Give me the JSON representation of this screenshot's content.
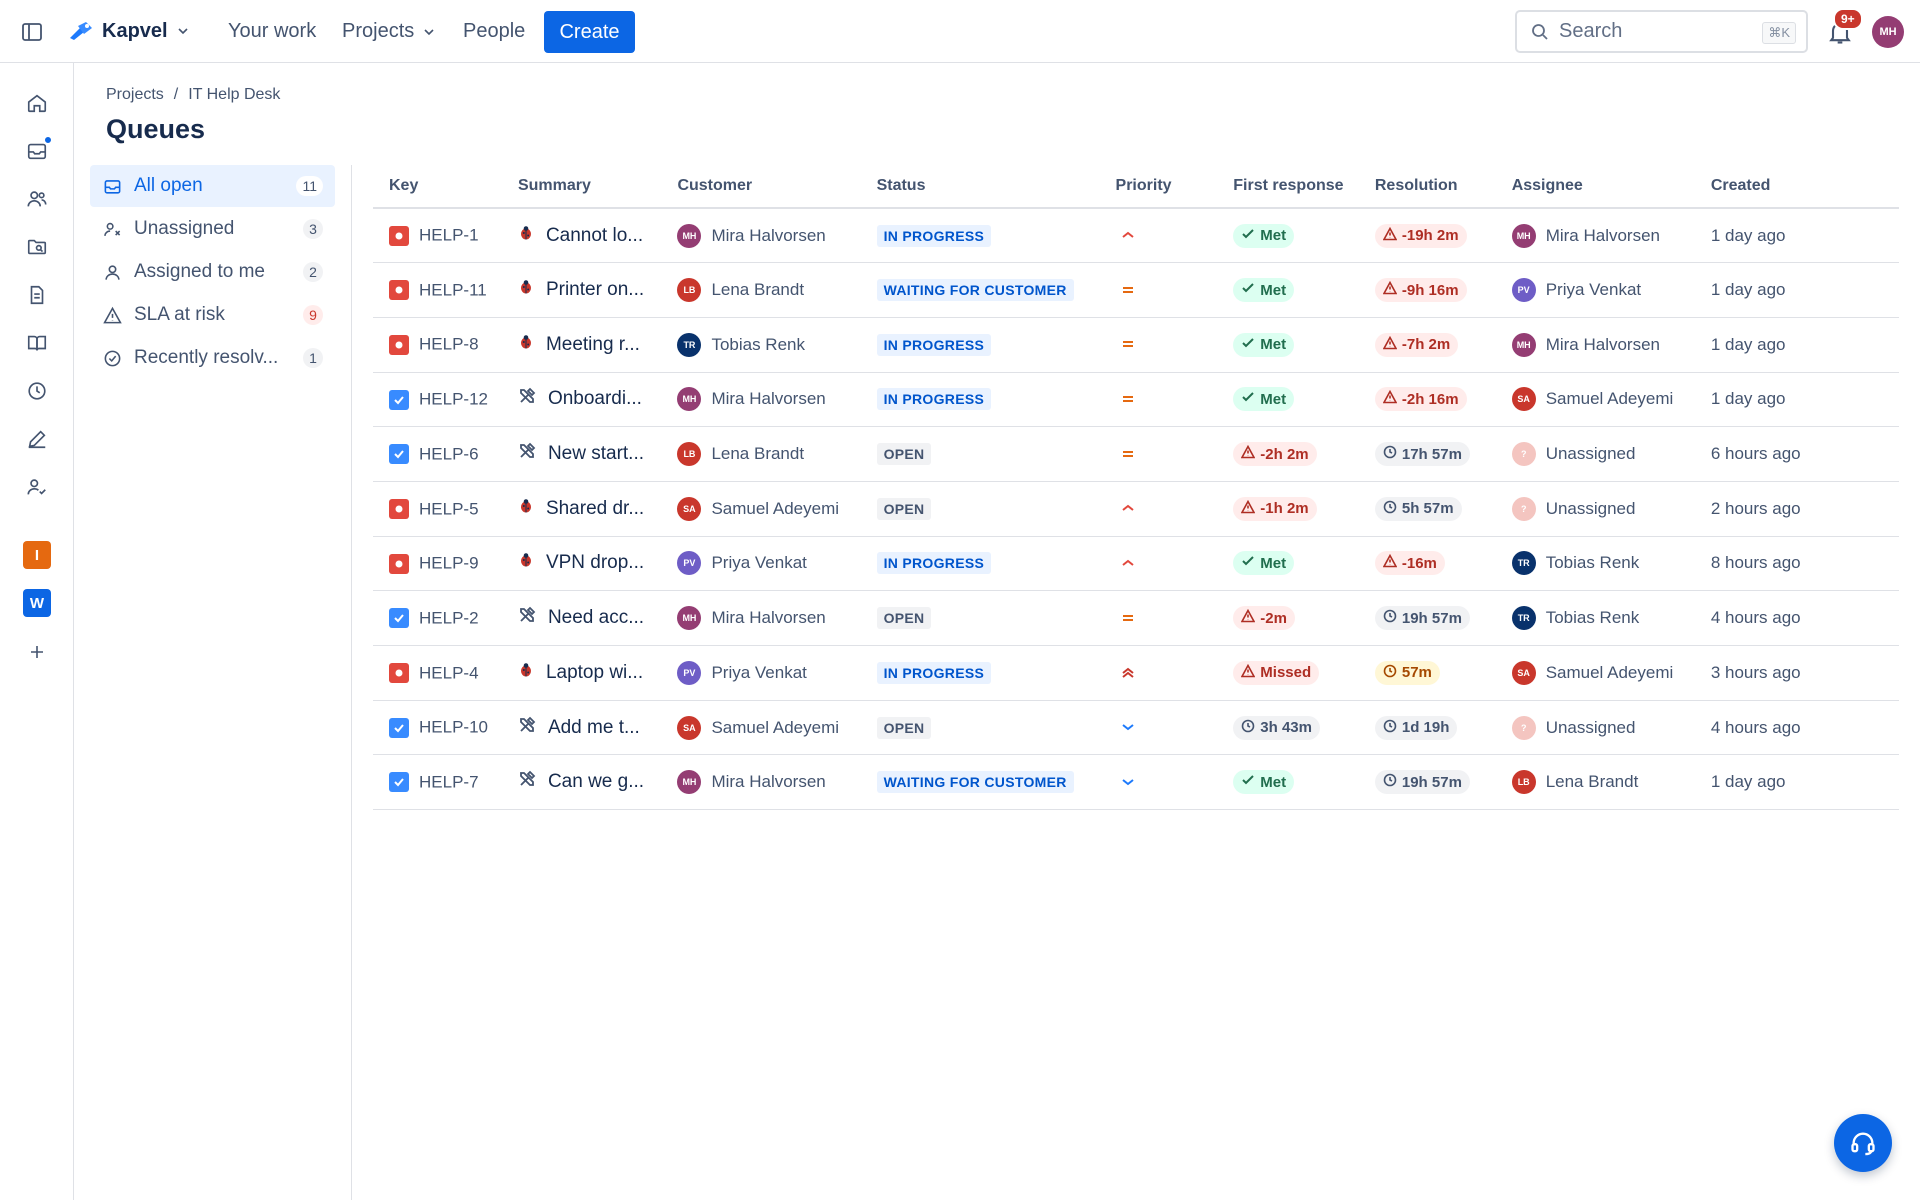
{
  "app": {
    "name": "Kapvel"
  },
  "nav": {
    "your_work": "Your work",
    "projects": "Projects",
    "people": "People",
    "create": "Create"
  },
  "search": {
    "placeholder": "Search",
    "shortcut": "⌘K"
  },
  "notifications": {
    "badge": "9+"
  },
  "user": {
    "initials": "MH"
  },
  "sidebar_projects": [
    {
      "letter": "I",
      "color": "#e56910"
    },
    {
      "letter": "W",
      "color": "#0c66e4"
    }
  ],
  "breadcrumb": {
    "root": "Projects",
    "separator": "/",
    "project": "IT Help Desk"
  },
  "page": {
    "title": "Queues"
  },
  "queues": [
    {
      "label": "All open",
      "count": "11",
      "icon": "inbox-icon"
    },
    {
      "label": "Unassigned",
      "count": "3",
      "icon": "user-x-icon"
    },
    {
      "label": "Assigned to me",
      "count": "2",
      "icon": "user-icon"
    },
    {
      "label": "SLA at risk",
      "count": "9",
      "icon": "warning-icon"
    },
    {
      "label": "Recently resolv...",
      "count": "1",
      "icon": "check-circle-icon"
    }
  ],
  "table": {
    "headers": [
      "Key",
      "Summary",
      "Customer",
      "Status",
      "Priority",
      "First response",
      "Resolution",
      "Assignee",
      "Created"
    ],
    "rows": [
      {
        "type": "bug",
        "key": "HELP-1",
        "summary": "Cannot lo...",
        "customer": "Mira Halvorsen",
        "customer_initials": "MH",
        "status": "IN PROGRESS",
        "priority": "high",
        "first_response": "Met",
        "first_state": "met",
        "resolution": "-19h 2m",
        "resolution_state": "breach",
        "assignee": "Mira Halvorsen",
        "assignee_initials": "MH",
        "created": "1 day ago"
      },
      {
        "type": "bug",
        "key": "HELP-11",
        "summary": "Printer on...",
        "customer": "Lena Brandt",
        "customer_initials": "LB",
        "status": "WAITING FOR CUSTOMER",
        "priority": "medium",
        "first_response": "Met",
        "first_state": "met",
        "resolution": "-9h 16m",
        "resolution_state": "breach",
        "assignee": "Priya Venkat",
        "assignee_initials": "PV",
        "created": "1 day ago"
      },
      {
        "type": "bug",
        "key": "HELP-8",
        "summary": "Meeting r...",
        "customer": "Tobias Renk",
        "customer_initials": "TR",
        "status": "IN PROGRESS",
        "priority": "medium",
        "first_response": "Met",
        "first_state": "met",
        "resolution": "-7h 2m",
        "resolution_state": "breach",
        "assignee": "Mira Halvorsen",
        "assignee_initials": "MH",
        "created": "1 day ago"
      },
      {
        "type": "task",
        "key": "HELP-12",
        "summary": "Onboardi...",
        "customer": "Mira Halvorsen",
        "customer_initials": "MH",
        "status": "IN PROGRESS",
        "priority": "medium",
        "first_response": "Met",
        "first_state": "met",
        "resolution": "-2h 16m",
        "resolution_state": "breach",
        "assignee": "Samuel Adeyemi",
        "assignee_initials": "SA",
        "created": "1 day ago"
      },
      {
        "type": "task",
        "key": "HELP-6",
        "summary": "New start...",
        "customer": "Lena Brandt",
        "customer_initials": "LB",
        "status": "OPEN",
        "priority": "medium",
        "first_response": "-2h 2m",
        "first_state": "breach",
        "resolution": "17h 57m",
        "resolution_state": "run",
        "assignee": "Unassigned",
        "assignee_initials": "?",
        "created": "6 hours ago"
      },
      {
        "type": "bug",
        "key": "HELP-5",
        "summary": "Shared dr...",
        "customer": "Samuel Adeyemi",
        "customer_initials": "SA",
        "status": "OPEN",
        "priority": "high",
        "first_response": "-1h 2m",
        "first_state": "breach",
        "resolution": "5h 57m",
        "resolution_state": "run",
        "assignee": "Unassigned",
        "assignee_initials": "?",
        "created": "2 hours ago"
      },
      {
        "type": "bug",
        "key": "HELP-9",
        "summary": "VPN drop...",
        "customer": "Priya Venkat",
        "customer_initials": "PV",
        "status": "IN PROGRESS",
        "priority": "high",
        "first_response": "Met",
        "first_state": "met",
        "resolution": "-16m",
        "resolution_state": "breach",
        "assignee": "Tobias Renk",
        "assignee_initials": "TR",
        "created": "8 hours ago"
      },
      {
        "type": "task",
        "key": "HELP-2",
        "summary": "Need acc...",
        "customer": "Mira Halvorsen",
        "customer_initials": "MH",
        "status": "OPEN",
        "priority": "medium",
        "first_response": "-2m",
        "first_state": "breach",
        "resolution": "19h 57m",
        "resolution_state": "run",
        "assignee": "Tobias Renk",
        "assignee_initials": "TR",
        "created": "4 hours ago"
      },
      {
        "type": "bug",
        "key": "HELP-4",
        "summary": "Laptop wi...",
        "customer": "Priya Venkat",
        "customer_initials": "PV",
        "status": "IN PROGRESS",
        "priority": "highest",
        "first_response": "Missed",
        "first_state": "breach",
        "resolution": "57m",
        "resolution_state": "warn",
        "assignee": "Samuel Adeyemi",
        "assignee_initials": "SA",
        "created": "3 hours ago"
      },
      {
        "type": "task",
        "key": "HELP-10",
        "summary": "Add me t...",
        "customer": "Samuel Adeyemi",
        "customer_initials": "SA",
        "status": "OPEN",
        "priority": "low",
        "first_response": "3h 43m",
        "first_state": "run",
        "resolution": "1d 19h",
        "resolution_state": "run",
        "assignee": "Unassigned",
        "assignee_initials": "?",
        "created": "4 hours ago"
      },
      {
        "type": "task",
        "key": "HELP-7",
        "summary": "Can we g...",
        "customer": "Mira Halvorsen",
        "customer_initials": "MH",
        "status": "WAITING FOR CUSTOMER",
        "priority": "low",
        "first_response": "Met",
        "first_state": "met",
        "resolution": "19h 57m",
        "resolution_state": "run",
        "assignee": "Lena Brandt",
        "assignee_initials": "LB",
        "created": "1 day ago"
      }
    ]
  },
  "avatar_colors": {
    "MH": "#943d73",
    "LB": "#c9372c",
    "TR": "#09326c",
    "SA": "#c9372c",
    "PV": "#6e5dc6",
    "?": "#f4c5c0"
  },
  "priority_colors": {
    "highest": "#c9372c",
    "high": "#e2483d",
    "medium": "#e56910",
    "low": "#1d7afc"
  }
}
